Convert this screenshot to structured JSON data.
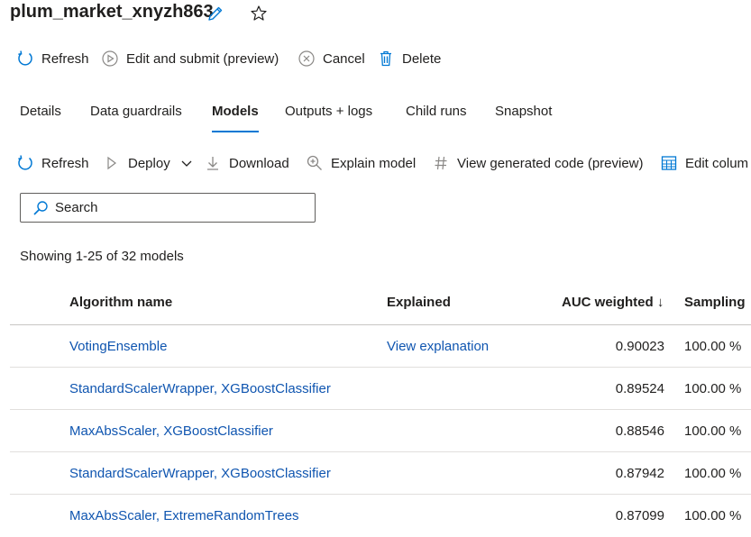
{
  "run_title": "plum_market_xnyzh863",
  "title_icons": [
    "pencil-edit-icon",
    "star-icon"
  ],
  "run_commands": [
    {
      "label": "Refresh",
      "icon": "refresh-icon"
    },
    {
      "label": "Edit and submit (preview)",
      "icon": "play-circle-icon"
    },
    {
      "label": "Cancel",
      "icon": "cancel-circle-icon"
    },
    {
      "label": "Delete",
      "icon": "trash-icon"
    }
  ],
  "tabs": [
    {
      "label": "Details",
      "active": false
    },
    {
      "label": "Data guardrails",
      "active": false
    },
    {
      "label": "Models",
      "active": true
    },
    {
      "label": "Outputs + logs",
      "active": false
    },
    {
      "label": "Child runs",
      "active": false
    },
    {
      "label": "Snapshot",
      "active": false
    }
  ],
  "model_commands": [
    {
      "label": "Refresh",
      "icon": "refresh-icon"
    },
    {
      "label": "Deploy",
      "icon": "deploy-icon",
      "dropdown": true
    },
    {
      "label": "Download",
      "icon": "download-icon"
    },
    {
      "label": "Explain model",
      "icon": "explain-icon"
    },
    {
      "label": "View generated code (preview)",
      "icon": "hash-icon"
    },
    {
      "label": "Edit colum",
      "icon": "edit-columns-icon"
    }
  ],
  "search": {
    "placeholder": "Search",
    "value": ""
  },
  "showing_text": "Showing 1-25 of 32 models",
  "table": {
    "columns": {
      "algorithm": "Algorithm name",
      "explained": "Explained",
      "auc": "AUC weighted ↓",
      "sampling": "Sampling"
    },
    "rows": [
      {
        "algorithm": "VotingEnsemble",
        "explained": "View explanation",
        "auc": "0.90023",
        "sampling": "100.00 %"
      },
      {
        "algorithm": "StandardScalerWrapper, XGBoostClassifier",
        "explained": "",
        "auc": "0.89524",
        "sampling": "100.00 %"
      },
      {
        "algorithm": "MaxAbsScaler, XGBoostClassifier",
        "explained": "",
        "auc": "0.88546",
        "sampling": "100.00 %"
      },
      {
        "algorithm": "StandardScalerWrapper, XGBoostClassifier",
        "explained": "",
        "auc": "0.87942",
        "sampling": "100.00 %"
      },
      {
        "algorithm": "MaxAbsScaler, ExtremeRandomTrees",
        "explained": "",
        "auc": "0.87099",
        "sampling": "100.00 %"
      }
    ]
  },
  "colors": {
    "accent": "#0078d4",
    "link": "#0f55b0",
    "text": "#201f1e"
  }
}
